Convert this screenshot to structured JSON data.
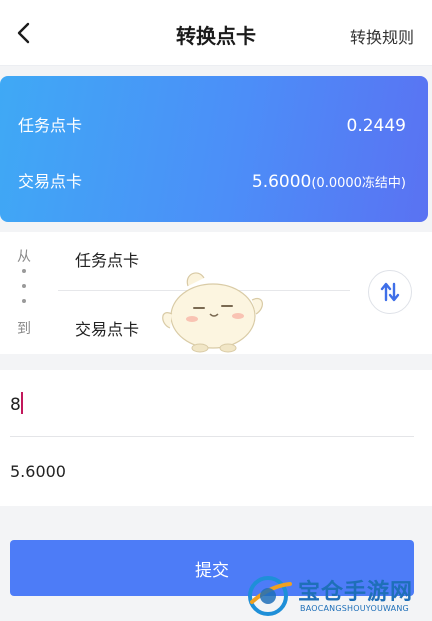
{
  "header": {
    "title": "转换点卡",
    "rule_label": "转换规则"
  },
  "balance": {
    "task_label": "任务点卡",
    "task_value": "0.2449",
    "trade_label": "交易点卡",
    "trade_value": "5.6000",
    "trade_frozen": "(0.0000冻结中)"
  },
  "transfer": {
    "from_caption": "从",
    "to_caption": "到",
    "from_value": "任务点卡",
    "to_value": "交易点卡"
  },
  "form": {
    "amount_value": "8",
    "available": "5.6000"
  },
  "submit_label": "提交",
  "watermark": {
    "text": "宝仓手游网",
    "en": "BAOCANGSHOUYOUWANG"
  },
  "icons": {
    "back": "chevron-left-icon",
    "swap": "swap-arrows-icon"
  },
  "colors": {
    "accent": "#4d7cf7",
    "card_gradient_start": "#3fa9f5",
    "card_gradient_end": "#5a72f2"
  }
}
